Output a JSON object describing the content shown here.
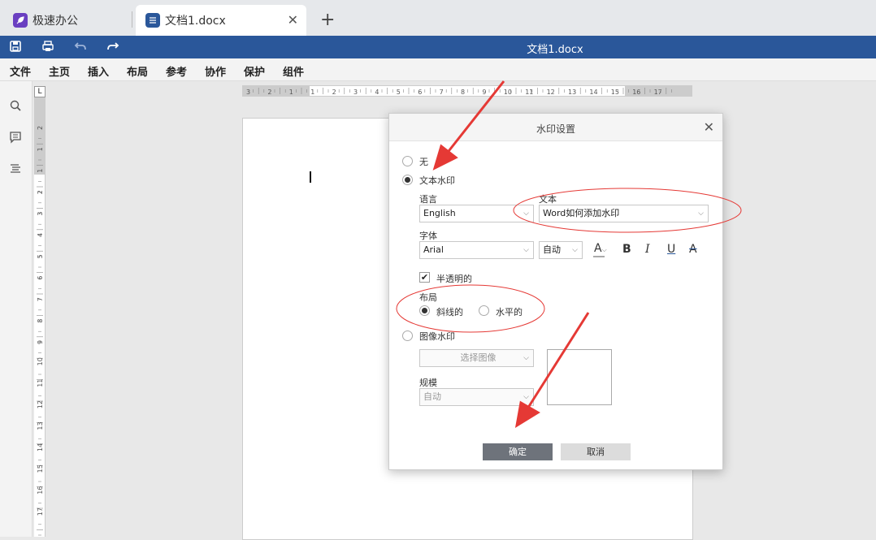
{
  "tabs": [
    {
      "label": "极速办公",
      "icon": "rocket-icon",
      "color": "#6a3fc1"
    },
    {
      "label": "文档1.docx",
      "icon": "document-icon",
      "color": "#2a579a"
    }
  ],
  "titlebar": {
    "title": "文档1.docx"
  },
  "menu": [
    "文件",
    "主页",
    "插入",
    "布局",
    "参考",
    "协作",
    "保护",
    "组件"
  ],
  "ruler": {
    "h_ticks": [
      "3",
      "2",
      "1",
      "1",
      "2",
      "3",
      "4",
      "5",
      "6",
      "7",
      "8",
      "9",
      "10",
      "11",
      "12",
      "13",
      "14",
      "15",
      "16",
      "17"
    ],
    "v_ticks": [
      "2",
      "1",
      "1",
      "2",
      "3",
      "4",
      "5",
      "6",
      "7",
      "8",
      "9",
      "10",
      "11",
      "12",
      "13",
      "14",
      "15",
      "16",
      "17"
    ]
  },
  "dialog": {
    "title": "水印设置",
    "none_label": "无",
    "text_watermark_label": "文本水印",
    "language_label": "语言",
    "language_value": "English",
    "text_label": "文本",
    "text_value": "Word如何添加水印",
    "font_label": "字体",
    "font_value": "Arial",
    "size_value": "自动",
    "semi_transparent_label": "半透明的",
    "layout_label": "布局",
    "diagonal_label": "斜线的",
    "horizontal_label": "水平的",
    "image_watermark_label": "图像水印",
    "select_image_label": "选择图像",
    "scale_label": "规模",
    "scale_value": "自动",
    "ok_label": "确定",
    "cancel_label": "取消"
  },
  "colors": {
    "accent": "#2a579a",
    "annotation": "#e53935"
  }
}
